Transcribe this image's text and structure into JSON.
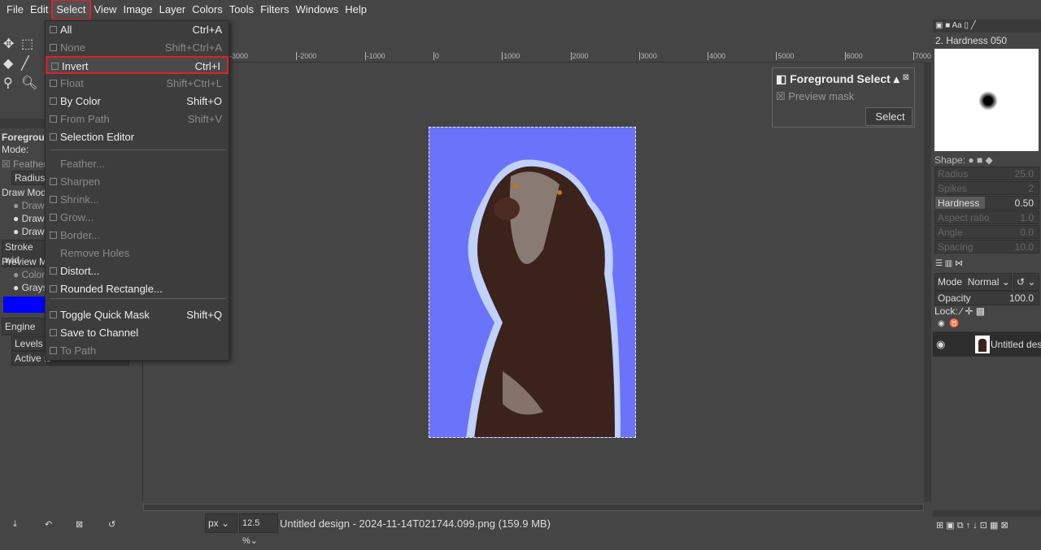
{
  "menubar": [
    "File",
    "Edit",
    "Select",
    "View",
    "Image",
    "Layer",
    "Colors",
    "Tools",
    "Filters",
    "Windows",
    "Help"
  ],
  "select_menu": [
    {
      "label": "All",
      "shortcut": "Ctrl+A",
      "enabled": true
    },
    {
      "label": "None",
      "shortcut": "Shift+Ctrl+A",
      "enabled": false
    },
    {
      "label": "Invert",
      "shortcut": "Ctrl+I",
      "enabled": true,
      "highlighted": true
    },
    {
      "label": "Float",
      "shortcut": "Shift+Ctrl+L",
      "enabled": false
    },
    {
      "label": "By Color",
      "shortcut": "Shift+O",
      "enabled": true
    },
    {
      "label": "From Path",
      "shortcut": "Shift+V",
      "enabled": false
    },
    {
      "label": "Selection Editor",
      "shortcut": "",
      "enabled": true
    },
    {
      "label": "Feather...",
      "shortcut": "",
      "enabled": false
    },
    {
      "label": "Sharpen",
      "shortcut": "",
      "enabled": false
    },
    {
      "label": "Shrink...",
      "shortcut": "",
      "enabled": false
    },
    {
      "label": "Grow...",
      "shortcut": "",
      "enabled": false
    },
    {
      "label": "Border...",
      "shortcut": "",
      "enabled": false
    },
    {
      "label": "Remove Holes",
      "shortcut": "",
      "enabled": false
    },
    {
      "label": "Distort...",
      "shortcut": "",
      "enabled": true
    },
    {
      "label": "Rounded Rectangle...",
      "shortcut": "",
      "enabled": true
    },
    {
      "label": "Toggle Quick Mask",
      "shortcut": "Shift+Q",
      "enabled": true
    },
    {
      "label": "Save to Channel",
      "shortcut": "",
      "enabled": true
    },
    {
      "label": "To Path",
      "shortcut": "",
      "enabled": false
    }
  ],
  "tool_options": {
    "title": "Foregrou",
    "mode": "Mode:",
    "feather": "Feather",
    "radius": "Radius",
    "draw_mode": "Draw Mode",
    "draw1": "Draw",
    "draw2": "Draw",
    "draw3": "Draw",
    "stroke": "Stroke wid",
    "preview_mode": "Preview Mo",
    "color": "Color",
    "grays": "Grays",
    "engine": "Engine",
    "levels": "Levels",
    "active": "Active le"
  },
  "ruler": [
    "-3000",
    "-2000",
    "-1000",
    "0",
    "1000",
    "2000",
    "3000",
    "4000",
    "5000",
    "6000",
    "7000"
  ],
  "fg_dialog": {
    "title": "Foreground Select",
    "preview": "Preview mask",
    "select": "Select"
  },
  "brushes": {
    "name": "2. Hardness 050",
    "shape": "Shape:",
    "params": [
      {
        "label": "Radius",
        "value": "25.0"
      },
      {
        "label": "Spikes",
        "value": "2"
      },
      {
        "label": "Hardness",
        "value": "0.50"
      },
      {
        "label": "Aspect ratio",
        "value": "1.0"
      },
      {
        "label": "Angle",
        "value": "0.0"
      },
      {
        "label": "Spacing",
        "value": "10.0"
      }
    ]
  },
  "layers": {
    "mode_label": "Mode",
    "mode": "Normal",
    "opacity_label": "Opacity",
    "opacity": "100.0",
    "lock": "Lock:",
    "layer_name": "Untitled desi"
  },
  "status": {
    "unit": "px",
    "zoom": "12.5 %",
    "file": "Untitled design - 2024-11-14T021744.099.png (159.9 MB)"
  },
  "colors": {
    "selection_bg": "#6b73fa",
    "highlight": "#e0202a",
    "fg_color": "#0000ff"
  }
}
